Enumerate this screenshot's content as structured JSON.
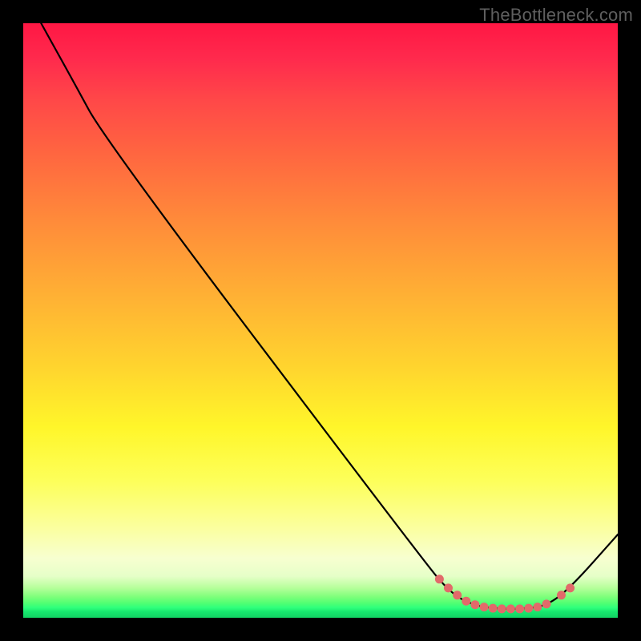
{
  "watermark": "TheBottleneck.com",
  "chart_data": {
    "type": "line",
    "title": "",
    "xlabel": "",
    "ylabel": "",
    "xlim": [
      0,
      100
    ],
    "ylim": [
      0,
      100
    ],
    "background_gradient": {
      "orientation": "vertical",
      "stops": [
        {
          "pos": 0,
          "color": "#ff1744"
        },
        {
          "pos": 50,
          "color": "#ffd52e"
        },
        {
          "pos": 85,
          "color": "#f7ffd0"
        },
        {
          "pos": 100,
          "color": "#12d264"
        }
      ]
    },
    "series": [
      {
        "name": "bottleneck-curve",
        "color": "#000000",
        "points": [
          {
            "x": 3,
            "y": 100
          },
          {
            "x": 8,
            "y": 91
          },
          {
            "x": 14,
            "y": 80
          },
          {
            "x": 67,
            "y": 10
          },
          {
            "x": 72,
            "y": 4
          },
          {
            "x": 76,
            "y": 2
          },
          {
            "x": 80,
            "y": 1.5
          },
          {
            "x": 84,
            "y": 1.5
          },
          {
            "x": 88,
            "y": 2
          },
          {
            "x": 92,
            "y": 5
          },
          {
            "x": 100,
            "y": 14
          }
        ]
      }
    ],
    "markers": {
      "name": "optimal-range-dots",
      "color": "#e26a6a",
      "points": [
        {
          "x": 70,
          "y": 6.5
        },
        {
          "x": 71.5,
          "y": 5
        },
        {
          "x": 73,
          "y": 3.8
        },
        {
          "x": 74.5,
          "y": 2.8
        },
        {
          "x": 76,
          "y": 2.2
        },
        {
          "x": 77.5,
          "y": 1.8
        },
        {
          "x": 79,
          "y": 1.6
        },
        {
          "x": 80.5,
          "y": 1.5
        },
        {
          "x": 82,
          "y": 1.5
        },
        {
          "x": 83.5,
          "y": 1.5
        },
        {
          "x": 85,
          "y": 1.6
        },
        {
          "x": 86.5,
          "y": 1.8
        },
        {
          "x": 88,
          "y": 2.3
        },
        {
          "x": 90.5,
          "y": 3.8
        },
        {
          "x": 92,
          "y": 5
        }
      ]
    }
  }
}
